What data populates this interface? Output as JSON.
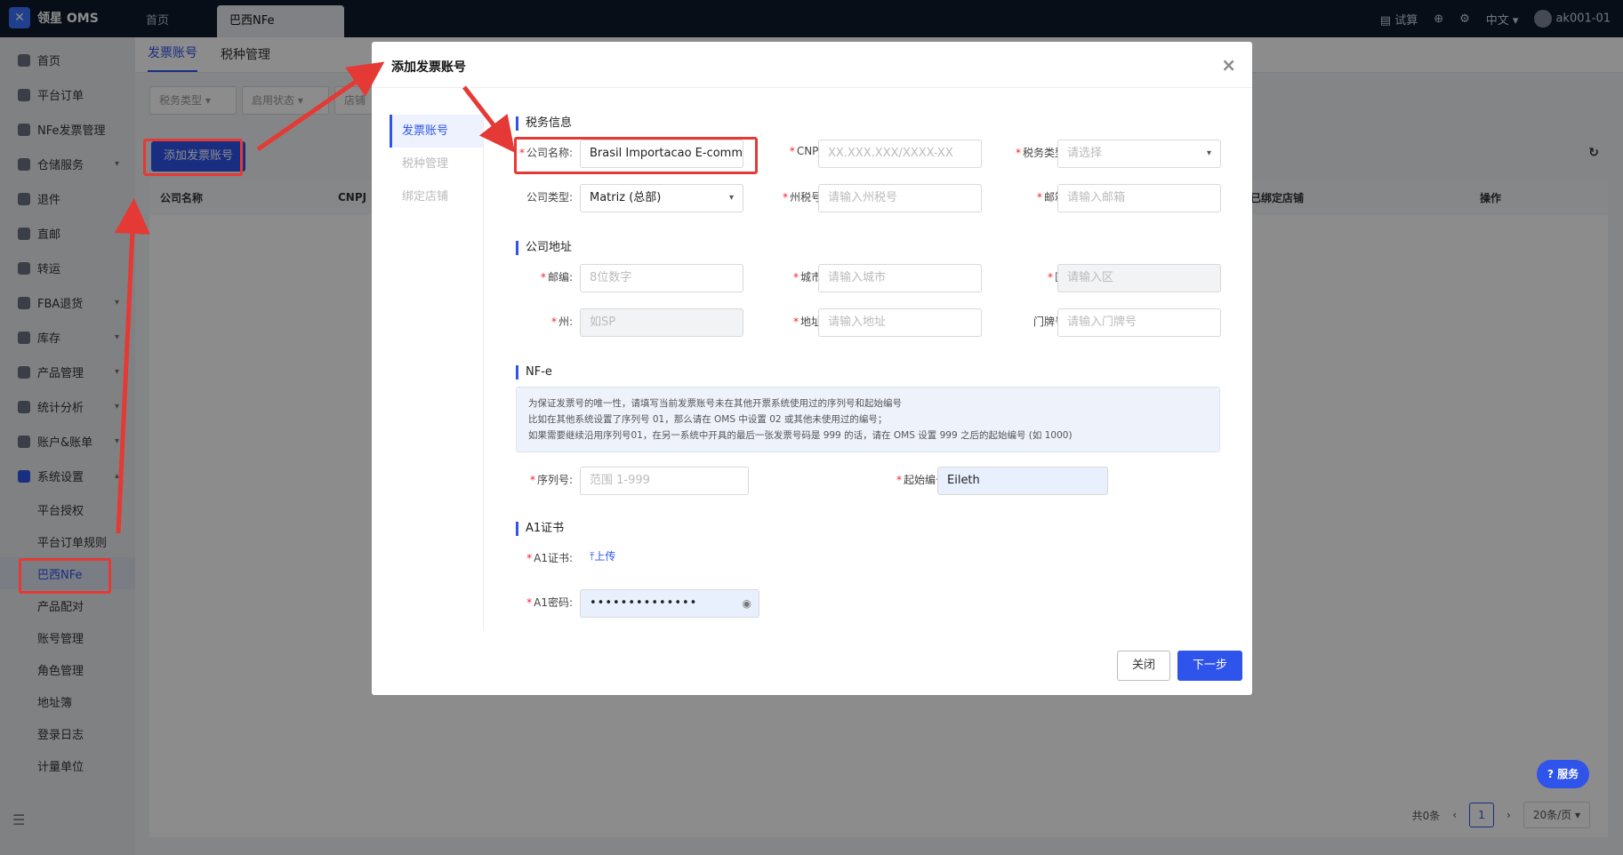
{
  "app": {
    "logo_text": "领星 OMS",
    "logo_glyph": "✕"
  },
  "top_tabs": [
    {
      "label": "首页"
    },
    {
      "label": "巴西NFe"
    }
  ],
  "top_right": {
    "trial": "试算",
    "lang": "中文",
    "user": "ak001-01"
  },
  "sidebar": {
    "items": [
      {
        "label": "首页"
      },
      {
        "label": "平台订单"
      },
      {
        "label": "NFe发票管理"
      },
      {
        "label": "仓储服务"
      },
      {
        "label": "退件"
      },
      {
        "label": "直邮"
      },
      {
        "label": "转运"
      },
      {
        "label": "FBA退货"
      },
      {
        "label": "库存"
      },
      {
        "label": "产品管理"
      },
      {
        "label": "统计分析"
      },
      {
        "label": "账户&账单"
      },
      {
        "label": "系统设置"
      }
    ],
    "sub_items": [
      {
        "label": "平台授权"
      },
      {
        "label": "平台订单规则"
      },
      {
        "label": "巴西NFe"
      },
      {
        "label": "产品配对"
      },
      {
        "label": "账号管理"
      },
      {
        "label": "角色管理"
      },
      {
        "label": "地址簿"
      },
      {
        "label": "登录日志"
      },
      {
        "label": "计量单位"
      }
    ]
  },
  "page": {
    "tabs": [
      {
        "label": "发票账号"
      },
      {
        "label": "税种管理"
      }
    ],
    "filters": [
      {
        "label": "税务类型"
      },
      {
        "label": "启用状态"
      },
      {
        "label": "店铺"
      }
    ],
    "add_button": "添加发票账号",
    "columns": [
      "公司名称",
      "CNPJ",
      "已绑定店铺",
      "操作"
    ],
    "pager": {
      "total": "共0条",
      "page": "1",
      "size": "20条/页"
    }
  },
  "modal": {
    "title": "添加发票账号",
    "nav": [
      {
        "label": "发票账号"
      },
      {
        "label": "税种管理"
      },
      {
        "label": "绑定店铺"
      }
    ],
    "sections": {
      "tax": "税务信息",
      "address": "公司地址",
      "nfe": "NF-e",
      "a1": "A1证书"
    },
    "fields": {
      "company_name": {
        "label": "公司名称:",
        "value": "Brasil Importacao E-comm"
      },
      "cnpj": {
        "label": "CNPJ:",
        "placeholder": "XX.XXX.XXX/XXXX-XX"
      },
      "tax_type": {
        "label": "税务类型:",
        "placeholder": "请选择"
      },
      "company_type": {
        "label": "公司类型:",
        "value": "Matriz (总部)"
      },
      "state_tax": {
        "label": "州税号:",
        "placeholder": "请输入州税号"
      },
      "email": {
        "label": "邮箱:",
        "placeholder": "请输入邮箱"
      },
      "zip": {
        "label": "邮编:",
        "placeholder": "8位数字"
      },
      "city": {
        "label": "城市:",
        "placeholder": "请输入城市"
      },
      "district": {
        "label": "区:",
        "placeholder": "请输入区"
      },
      "state": {
        "label": "州:",
        "placeholder": "如SP"
      },
      "address": {
        "label": "地址:",
        "placeholder": "请输入地址"
      },
      "door": {
        "label": "门牌号:",
        "placeholder": "请输入门牌号"
      },
      "serial": {
        "label": "序列号:",
        "placeholder": "范围 1-999"
      },
      "start_no": {
        "label": "起始编号:",
        "value": "Eileth"
      },
      "a1_cert": {
        "label": "A1证书:",
        "upload": "上传"
      },
      "a1_pwd": {
        "label": "A1密码:",
        "value": "••••••••••••••"
      }
    },
    "note_lines": [
      "为保证发票号的唯一性，请填写当前发票账号未在其他开票系统使用过的序列号和起始编号",
      "比如在其他系统设置了序列号 01，那么请在 OMS 中设置 02 或其他未使用过的编号；",
      "如果需要继续沿用序列号01，在另一系统中开具的最后一张发票号码是 999 的话，请在 OMS 设置 999 之后的起始编号 (如 1000)"
    ],
    "buttons": {
      "close": "关闭",
      "next": "下一步"
    }
  },
  "help_button": "服务",
  "accent": "#2f54eb",
  "highlight": "#e53935"
}
